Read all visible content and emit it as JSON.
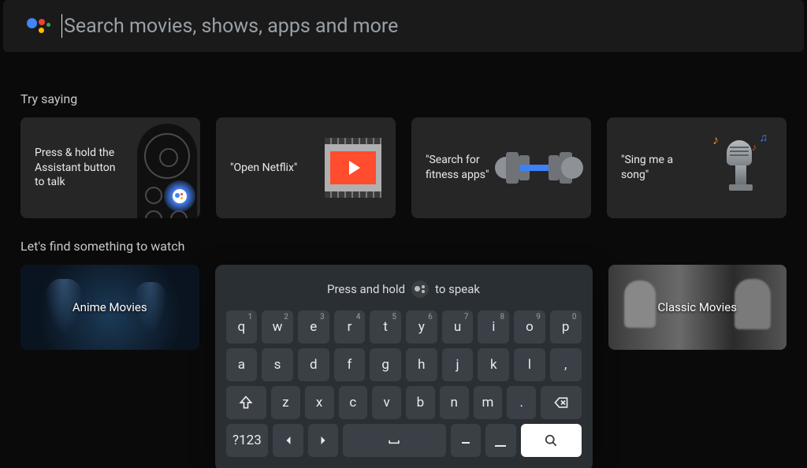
{
  "search": {
    "placeholder": "Search movies, shows, apps and more"
  },
  "sections": {
    "try_saying_label": "Try saying",
    "find_something_label": "Let's find something to watch"
  },
  "cards": [
    {
      "text": "Press & hold the Assistant button to talk"
    },
    {
      "text": "\"Open Netflix\""
    },
    {
      "text": "\"Search for fitness apps\""
    },
    {
      "text": "\"Sing me a song\""
    }
  ],
  "watch": [
    {
      "title": "Anime Movies"
    },
    {
      "title": "Classic Movies"
    }
  ],
  "keyboard": {
    "hint_before": "Press and hold",
    "hint_after": "to speak",
    "row1": [
      {
        "k": "q",
        "n": "1"
      },
      {
        "k": "w",
        "n": "2"
      },
      {
        "k": "e",
        "n": "3"
      },
      {
        "k": "r",
        "n": "4"
      },
      {
        "k": "t",
        "n": "5"
      },
      {
        "k": "y",
        "n": "6"
      },
      {
        "k": "u",
        "n": "7"
      },
      {
        "k": "i",
        "n": "8"
      },
      {
        "k": "o",
        "n": "9"
      },
      {
        "k": "p",
        "n": "0"
      }
    ],
    "row2": [
      "a",
      "s",
      "d",
      "f",
      "g",
      "h",
      "j",
      "k",
      "l",
      ","
    ],
    "row3": [
      "z",
      "x",
      "c",
      "v",
      "b",
      "n",
      "m",
      "."
    ],
    "symbols_key": "?123"
  }
}
